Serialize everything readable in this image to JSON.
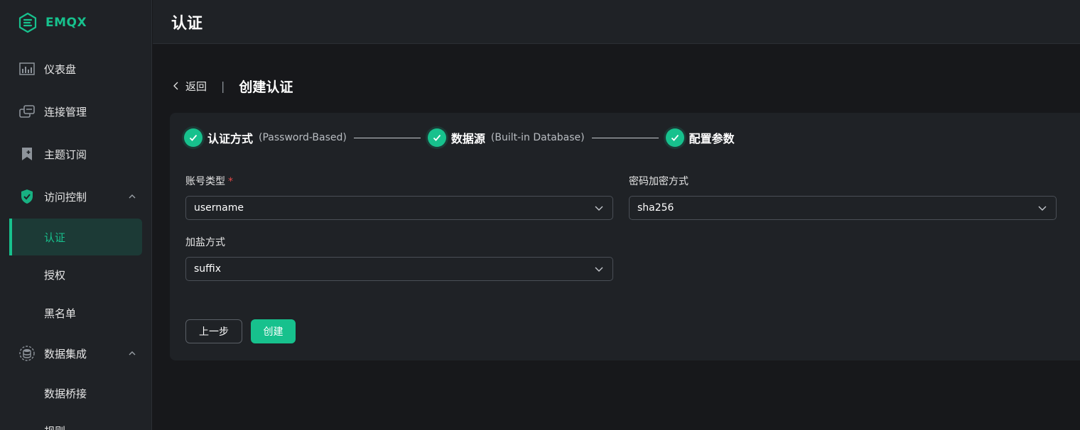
{
  "brand": {
    "name": "EMQX",
    "accent": "#17C18D"
  },
  "sidebar": {
    "items": [
      {
        "label": "仪表盘",
        "icon": "dashboard-icon"
      },
      {
        "label": "连接管理",
        "icon": "connections-icon"
      },
      {
        "label": "主题订阅",
        "icon": "bookmark-icon"
      },
      {
        "label": "访问控制",
        "icon": "shield-check-icon",
        "expanded": true
      },
      {
        "label": "数据集成",
        "icon": "database-icon",
        "expanded": true
      }
    ],
    "access_sub": [
      "认证",
      "授权",
      "黑名单"
    ],
    "data_sub": [
      "数据桥接",
      "规则"
    ]
  },
  "header": {
    "title": "认证"
  },
  "breadcrumb": {
    "back": "返回",
    "separator": "|",
    "title": "创建认证"
  },
  "steps": [
    {
      "title": "认证方式",
      "desc": "(Password-Based)"
    },
    {
      "title": "数据源",
      "desc": "(Built-in Database)"
    },
    {
      "title": "配置参数",
      "desc": ""
    }
  ],
  "form": {
    "account_type": {
      "label": "账号类型",
      "required_mark": "*",
      "value": "username"
    },
    "password_hash": {
      "label": "密码加密方式",
      "value": "sha256"
    },
    "salt_position": {
      "label": "加盐方式",
      "value": "suffix"
    }
  },
  "actions": {
    "prev": "上一步",
    "create": "创建"
  }
}
